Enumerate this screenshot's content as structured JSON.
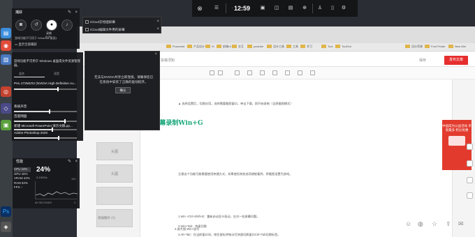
{
  "gamebar": {
    "time": "12:59",
    "icons": [
      "xbox-icon",
      "widget-menu-icon",
      "audio-icon",
      "capture-icon",
      "performance-icon",
      "xbox-social-icon",
      "gallery-icon",
      "controller-icon",
      "achievements-icon",
      "chat-icon",
      "settings-icon"
    ]
  },
  "capture_widget": {
    "title": "捕获",
    "record_label": "录制",
    "record_timer": "0:00",
    "hint": "游戏功能不可用于 Windows 桌面或文件资源管理器。",
    "show_all": "显示全部捕获"
  },
  "tab_popup": {
    "tabs": [
      {
        "label": "iCloud云绘图屏幕"
      },
      {
        "label": "iCloud编辑文件用的屏幕"
      }
    ]
  },
  "audio_widget": {
    "warning": "游戏功能不可用于 Windows 桌面或文件资源管理器。",
    "mix_tabs": [
      "混合",
      "语音"
    ],
    "device": "PHL 273M1R2 (NVIDIA High Definition Au...",
    "apps": [
      {
        "name": "系统声音",
        "level": 0.55
      },
      {
        "name": "百度网盘",
        "level": 0.8
      },
      {
        "name": "新建 Microsoft PowerPoint 演示文稿.pp...",
        "level": 0.6
      },
      {
        "name": "Adobe Photoshop 2020",
        "level": 0.7
      }
    ]
  },
  "notice": {
    "message": "无法与NVIDIA共享立即连接。请确保您已在系统中安装了正确的驱动程序。",
    "ok": "确认"
  },
  "performance": {
    "title": "性能",
    "cpu": "CPU 24%",
    "gpu": "GPU 16%",
    "vram": "VRAM 42%",
    "ram": "RAM 53%",
    "fps": "FPS --",
    "big_value": "24%",
    "sub": "3.13GHz",
    "axis_left": "60 SECONDS",
    "axis_right": "0",
    "axis_top": "100"
  },
  "browser": {
    "bookmarks": [
      "Flowchart",
      "产品设计",
      "IS",
      "前端UI",
      "交互",
      "youtube",
      "设计工具",
      "工具",
      "学习",
      "Tool",
      "ToolOut"
    ],
    "bookmarks_right": [
      "设计资源",
      "Font Finder",
      "New Wel"
    ],
    "topbar_text": "投稿须知",
    "save": "保存",
    "publish": "发布文章",
    "thumb_label": "头图",
    "thumb_footer": "添加图片 (7)",
    "line1": "▲ 选择设置后，切换应用，选择需要截图窗口，单击下载，即开始录制（全屏截图模式）",
    "heading": "4.屏幕录制Win+G",
    "line2": "注意这个功能可能需要使用快捷方式，如果使用其他选项就能看到，将截图设置为游戏。",
    "list": [
      "1.Win +Ctrl+Shift+B：重新启动显卡驱动，应对一些屏幕问题。",
      "2.Win+Tab：快速切换",
      "3.Alt+Tab：在当前窗口间，按住鼠标并拖动可快速切换窗口Ctrl+Tab切换标签。",
      "4.放大镜 Win+加号"
    ],
    "promo": "中国成为公益活动 享受最多 积分优惠"
  },
  "desktop": {
    "icons": [
      "chrome-icon",
      "folder-icon",
      "recycle-icon",
      "ps-icon",
      "app-icon"
    ]
  }
}
